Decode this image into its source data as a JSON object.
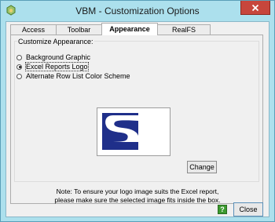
{
  "window": {
    "title": "VBM - Customization Options"
  },
  "tabs": [
    {
      "label": "Access",
      "active": false
    },
    {
      "label": "Toolbar",
      "active": false
    },
    {
      "label": "Appearance",
      "active": true
    },
    {
      "label": "RealFS",
      "active": false
    }
  ],
  "appearance": {
    "group_label": "Customize Appearance:",
    "options": [
      {
        "label": "Background Graphic",
        "selected": false
      },
      {
        "label": "Excel Reports Logo",
        "selected": true
      },
      {
        "label": "Alternate Row List Color Scheme",
        "selected": false
      }
    ],
    "change_label": "Change",
    "note_line1": "Note: To ensure your logo image suits the Excel report,",
    "note_line2": "please make sure the selected image fits inside the box."
  },
  "footer": {
    "help_label": "?",
    "close_label": "Close"
  },
  "colors": {
    "accent": "#ace0ed",
    "logo_blue": "#1f2f8a",
    "close_red": "#c7463c"
  }
}
